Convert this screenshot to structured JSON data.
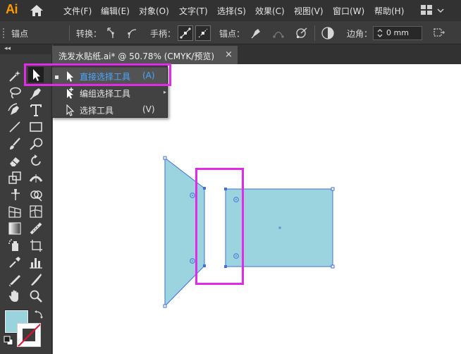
{
  "app": {
    "logo": "Ai",
    "menus": [
      "文件(F)",
      "编辑(E)",
      "对象(O)",
      "文字(T)",
      "选择(S)",
      "效果(C)",
      "视图(V)",
      "窗口(W)",
      "帮助(H)"
    ]
  },
  "controlbar": {
    "mode_label": "锚点",
    "convert_label": "转换：",
    "handles_label": "手柄：",
    "anchors_label": "锚点：",
    "corner_label": "边角：",
    "corner_value": "0 mm"
  },
  "document": {
    "tab_title": "洗发水贴纸.ai* @ 50.78% (CMYK/预览)",
    "close_glyph": "×"
  },
  "flyout": {
    "items": [
      {
        "label": "直接选择工具",
        "shortcut": "(A)",
        "selected": true,
        "icon": "direct-selection-icon"
      },
      {
        "label": "编组选择工具",
        "shortcut": "",
        "selected": false,
        "icon": "group-selection-icon"
      },
      {
        "label": "选择工具",
        "shortcut": "(V)",
        "selected": false,
        "icon": "selection-icon"
      }
    ]
  },
  "colors": {
    "fill": "#98d3de",
    "shape_fill": "#9bd4de",
    "selection_blue": "#3f6fd8",
    "annotation": "#e12be6",
    "stroke_none_slash": "#e8112d"
  }
}
